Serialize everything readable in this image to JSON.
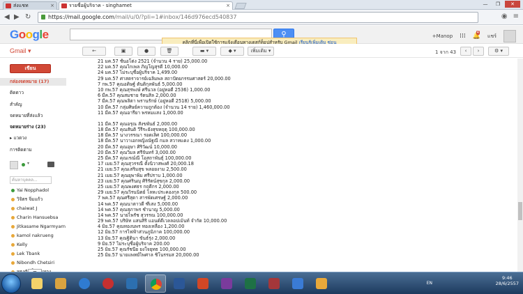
{
  "browser": {
    "tabs": [
      {
        "title": "ส่งแชท"
      },
      {
        "title": "รายชื่อผู้บริจาค - singhamet"
      }
    ],
    "url_host": "https://mail.google.com",
    "url_rest": "/mail/u/0/?pli=1#inbox/146d976ecd540837"
  },
  "header": {
    "logo": "Google",
    "user": "+Manop",
    "notifications": "4",
    "share_label": "แชร์",
    "search_btn_icon": "search-icon"
  },
  "banner": {
    "text": "คลิกที่นี่เพื่อเปิดใช้การแจ้งเตือนทางเดสก์ท็อปสำหรับ Gmail",
    "link1": "เรียนรู้เพิ่มเติม",
    "link2": "ซ่อน"
  },
  "toolbar": {
    "gmail_label": "Gmail ▾",
    "more_label": "เพิ่มเติม ▾",
    "pager": "1 จาก 43"
  },
  "sidebar": {
    "compose": "เขียน",
    "items": [
      {
        "label": "กล่องจดหมาย (17)",
        "style": "active"
      },
      {
        "label": "ติดดาว",
        "style": ""
      },
      {
        "label": "สำคัญ",
        "style": ""
      },
      {
        "label": "จดหมายที่ส่งแล้ว",
        "style": ""
      },
      {
        "label": "จดหมายร่าง (23)",
        "style": "bold"
      },
      {
        "label": "▸ แวดวง",
        "style": ""
      },
      {
        "label": "การติดตาม",
        "style": ""
      }
    ],
    "chat_search_placeholder": "ค้นหาบุคคล...",
    "contacts": [
      {
        "name": "Yai Nopphadol",
        "color": "#3c9a3c"
      },
      {
        "name": "วิจิตร จิ่มแก้ว",
        "color": "#e8a83a"
      },
      {
        "name": "chaiwat J",
        "color": "#e8a83a"
      },
      {
        "name": "Charin Hansuebsa",
        "color": "#e8a83a"
      },
      {
        "name": "Jitkasame Ngarmyarn",
        "color": "#e8a83a"
      },
      {
        "name": "kamol nakrueng",
        "color": "#e8a83a"
      },
      {
        "name": "Kelly",
        "color": "#e8a83a"
      },
      {
        "name": "Lek Tbank",
        "color": "#e8a83a"
      },
      {
        "name": "Nibondh Chetsiri",
        "color": "#e8a83a"
      },
      {
        "name": "ทรงศักดิ์ แก่นทอง",
        "color": "#e8a83a"
      }
    ]
  },
  "content": {
    "lines": [
      "21 มค.57 ชั้นอโต่ง 2521 (จำนวน 4 ราย) 25,000.00",
      "22 มค.57 คุณไกเพล ภิญโญสุรดี 10,000.00",
      "24 มค.57 ไม่ระบุชื่อผู้บริจาค 1,499.00",
      "29 มค.57 ศาสตราจารย์เฉลิมพล สถาปัตยกรรมศาสตร์ 20,000.00",
      "7 กพ.57 คุณอดิษฐ์ ตันติกุลพันธ์ 5,000.00",
      "10 กพ.57 คุณสุรพงษ์ ศรีนวล (อยู่หอดี 2536) 1,000.00",
      "6 มีค.57 คุณสมชาย รัตนสิล 2,000.00",
      "7 มีค.57 คุณพลิตา พรานรักษ์ (อยู่หอดี 2518) 5,000.00",
      "10 มีค.57 กลุ่มศิษย์ความถูกต้อง (จำนวน 14 ราย) 1,460,000.00",
      "11 มีค.57 คุณอารียา พรหมแสง 1,000.00",
      "",
      "11 มีค.57 คุณอรุณ สังขพันธ์ 2,000.00",
      "18 มีค.57 คุณสันติ วีรีระยังสุขหฤตุ 100,000.00",
      "18 มีค.57 นางวรรณา รอดเลิศ 100,000.00",
      "18 มีค.57 นาวาเอกหญิงณัฐณี กมล สวาทแดง 1,000.00",
      "20 มีค.57 คุณอุษา ศิริวัฒน์ 10,000.00",
      "20 มีค.57 คุณวิมล ศรีจันทร์ 3,000.00",
      "25 มีค.57 คุณเรณ์ณี โอสถาพันธุ์ 100,000.00",
      "17 เมย.57 คุณสุวรรณี ตั้งนิวาสพงศ์ 20,000.18",
      "21 เมย.57 คุณเสริมสุข พลอยงาม 2,500.00",
      "21 เมย.57 คุณยุพาพิม ศรีปราบ 1,000.00",
      "23 เมย.57 คุณศรินญุ ศิริรัตน์สุขกุล 2,000.00",
      "25 เมย.57 คุณพงศธร กฤดีกร 2,000.00",
      "29 เมย.57 คุณวิรนนิตย์ โลหะประคองกุล 500.00",
      "7 พค.57 คุณศรีสุดา สารพัดเศรษฐ์ 2,000.00",
      "14 พค.57 คุณนาตาวดี ฑีเสง 5,000.00",
      "14 พค.57 คุณสุภาพร ชำนาญ 5,000.00",
      "14 พค.57 นายไพรัช สุวรรณ 100,000.00",
      "29 พค.57 บริษัท แสนสิริ แอนด์ดีเวลลอปเม้นท์ จำกัด 10,000.00",
      "4 มิย.57 คุณทองนพร ทองเหลือง 1,200.00",
      "12 มิย.57 การไฟฟ้าส่วนภูมิภาค 100,000.00",
      "13 มิย.57 คุณฐิตินา ขันธ์รุ่ง 2,000.00",
      "9 มิย.57 ไม่ระบุชื่อผู้บริจาค 200.00",
      "25 มิย.57 คุณรัชนีย ยงใจยุทธ 100,000.00",
      "25 มิย.57 นายแพทย์ไพศาล ชิโนรรมส 20,000.00"
    ]
  },
  "taskbar": {
    "time": "9:46",
    "date": "28/6/2557",
    "lang": "EN"
  }
}
